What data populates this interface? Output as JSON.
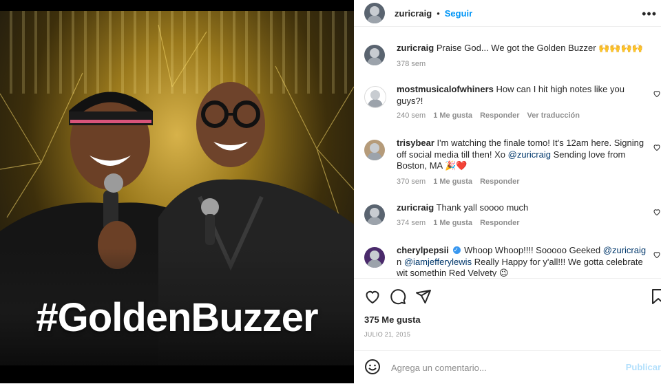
{
  "post": {
    "image_caption": "#GoldenBuzzer",
    "author": "zuricraig",
    "follow_label": "Seguir",
    "separator": "•"
  },
  "caption": {
    "username": "zuricraig",
    "text": "Praise God... We got the Golden Buzzer",
    "emoji": "🙌🙌🙌🙌",
    "time": "378 sem"
  },
  "comments": [
    {
      "username": "mostmusicalofwhiners",
      "text": "How can I hit high notes like you guys?!",
      "time": "240 sem",
      "likes": "1 Me gusta",
      "reply": "Responder",
      "translate": "Ver traducción"
    },
    {
      "username": "trisybear",
      "text": "I'm watching the finale tomo! It's 12am here. Signing off social media till then! Xo",
      "mention": "@zuricraig",
      "text2": "Sending love from Boston, MA",
      "emoji": "🎉❤️",
      "time": "370 sem",
      "likes": "1 Me gusta",
      "reply": "Responder"
    },
    {
      "username": "zuricraig",
      "text": "Thank yall soooo much",
      "time": "374 sem",
      "likes": "1 Me gusta",
      "reply": "Responder"
    },
    {
      "username": "cherylpepsii",
      "text": "Whoop Whoop!!!! Sooooo Geeked",
      "mention": "@zuricraig",
      "text2": "n",
      "mention2": "@iamjefferylewis",
      "text3": "Really Happy for y'all!!! We gotta celebrate wit somethin Red Velvety",
      "emoji": "😉"
    }
  ],
  "likes_count": "375 Me gusta",
  "date": "JULIO 21, 2015",
  "add_comment": {
    "placeholder": "Agrega un comentario...",
    "publish_label": "Publicar"
  },
  "colors": {
    "accent": "#0095f6",
    "mention": "#00376b",
    "muted": "#8e8e8e",
    "publish_disabled": "#b2dffc"
  }
}
